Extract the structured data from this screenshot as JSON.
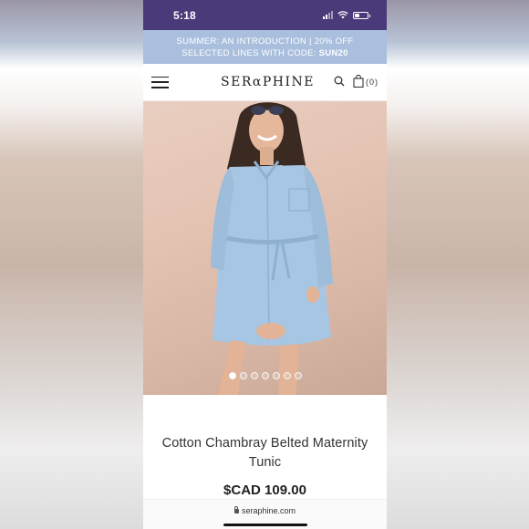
{
  "status_bar": {
    "time": "5:18"
  },
  "promo": {
    "line1": "SUMMER: AN INTRODUCTION | 20% OFF",
    "line2_prefix": "SELECTED LINES WITH CODE: ",
    "code": "SUN20"
  },
  "header": {
    "logo": "SERαPHINE",
    "cart_count": "(0)"
  },
  "gallery": {
    "image_alt": "Woman wearing light blue chambray belted maternity shirt dress",
    "dots_total": 7,
    "active_index": 0
  },
  "product": {
    "title": "Cotton Chambray Belted Maternity Tunic",
    "price": "$CAD 109.00"
  },
  "browser": {
    "url": "seraphine.com"
  },
  "colors": {
    "status_bar": "#4a3a79",
    "promo_bar": "#a9bfdd",
    "dress": "#a7c6e3"
  }
}
